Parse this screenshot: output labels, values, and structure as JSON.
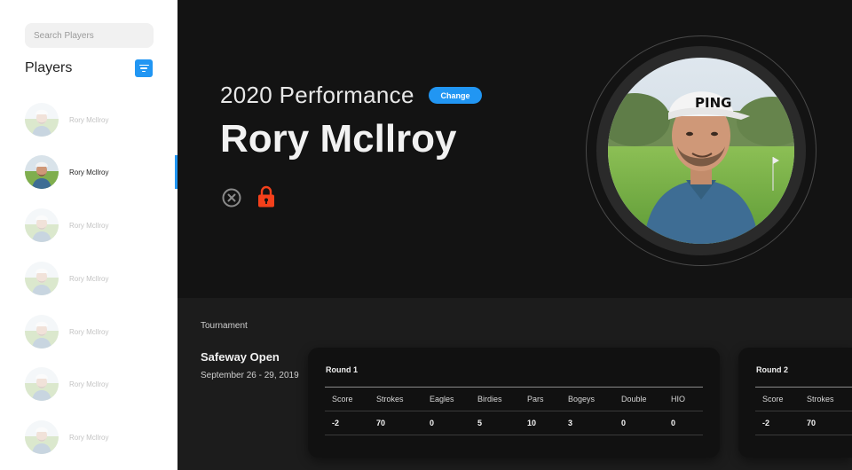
{
  "sidebar": {
    "search_placeholder": "Search Players",
    "title": "Players",
    "players": [
      {
        "name": "Rory Mcllroy",
        "active": false
      },
      {
        "name": "Rory Mcllroy",
        "active": true
      },
      {
        "name": "Rory Mcllroy",
        "active": false
      },
      {
        "name": "Rory Mcllroy",
        "active": false
      },
      {
        "name": "Rory Mcllroy",
        "active": false
      },
      {
        "name": "Rory Mcllroy",
        "active": false
      },
      {
        "name": "Rory Mcllroy",
        "active": false
      }
    ]
  },
  "header": {
    "performance_title": "2020 Performance",
    "change_label": "Change",
    "player_name": "Rory Mcllroy"
  },
  "tournament": {
    "label": "Tournament",
    "name": "Safeway Open",
    "dates": "September 26 - 29, 2019"
  },
  "rounds": [
    {
      "title": "Round 1",
      "columns": [
        "Score",
        "Strokes",
        "Eagles",
        "Birdies",
        "Pars",
        "Bogeys",
        "Double",
        "HIO"
      ],
      "values": [
        "-2",
        "70",
        "0",
        "5",
        "10",
        "3",
        "0",
        "0"
      ]
    },
    {
      "title": "Round 2",
      "columns": [
        "Score",
        "Strokes"
      ],
      "values": [
        "-2",
        "70"
      ]
    }
  ],
  "colors": {
    "accent": "#2196f3",
    "lock": "#f4401b",
    "header_bg": "#131313",
    "main_bg": "#1c1c1c"
  },
  "icons": {
    "filter": "filter-icon",
    "close": "close-circle-icon",
    "lock": "lock-icon"
  }
}
